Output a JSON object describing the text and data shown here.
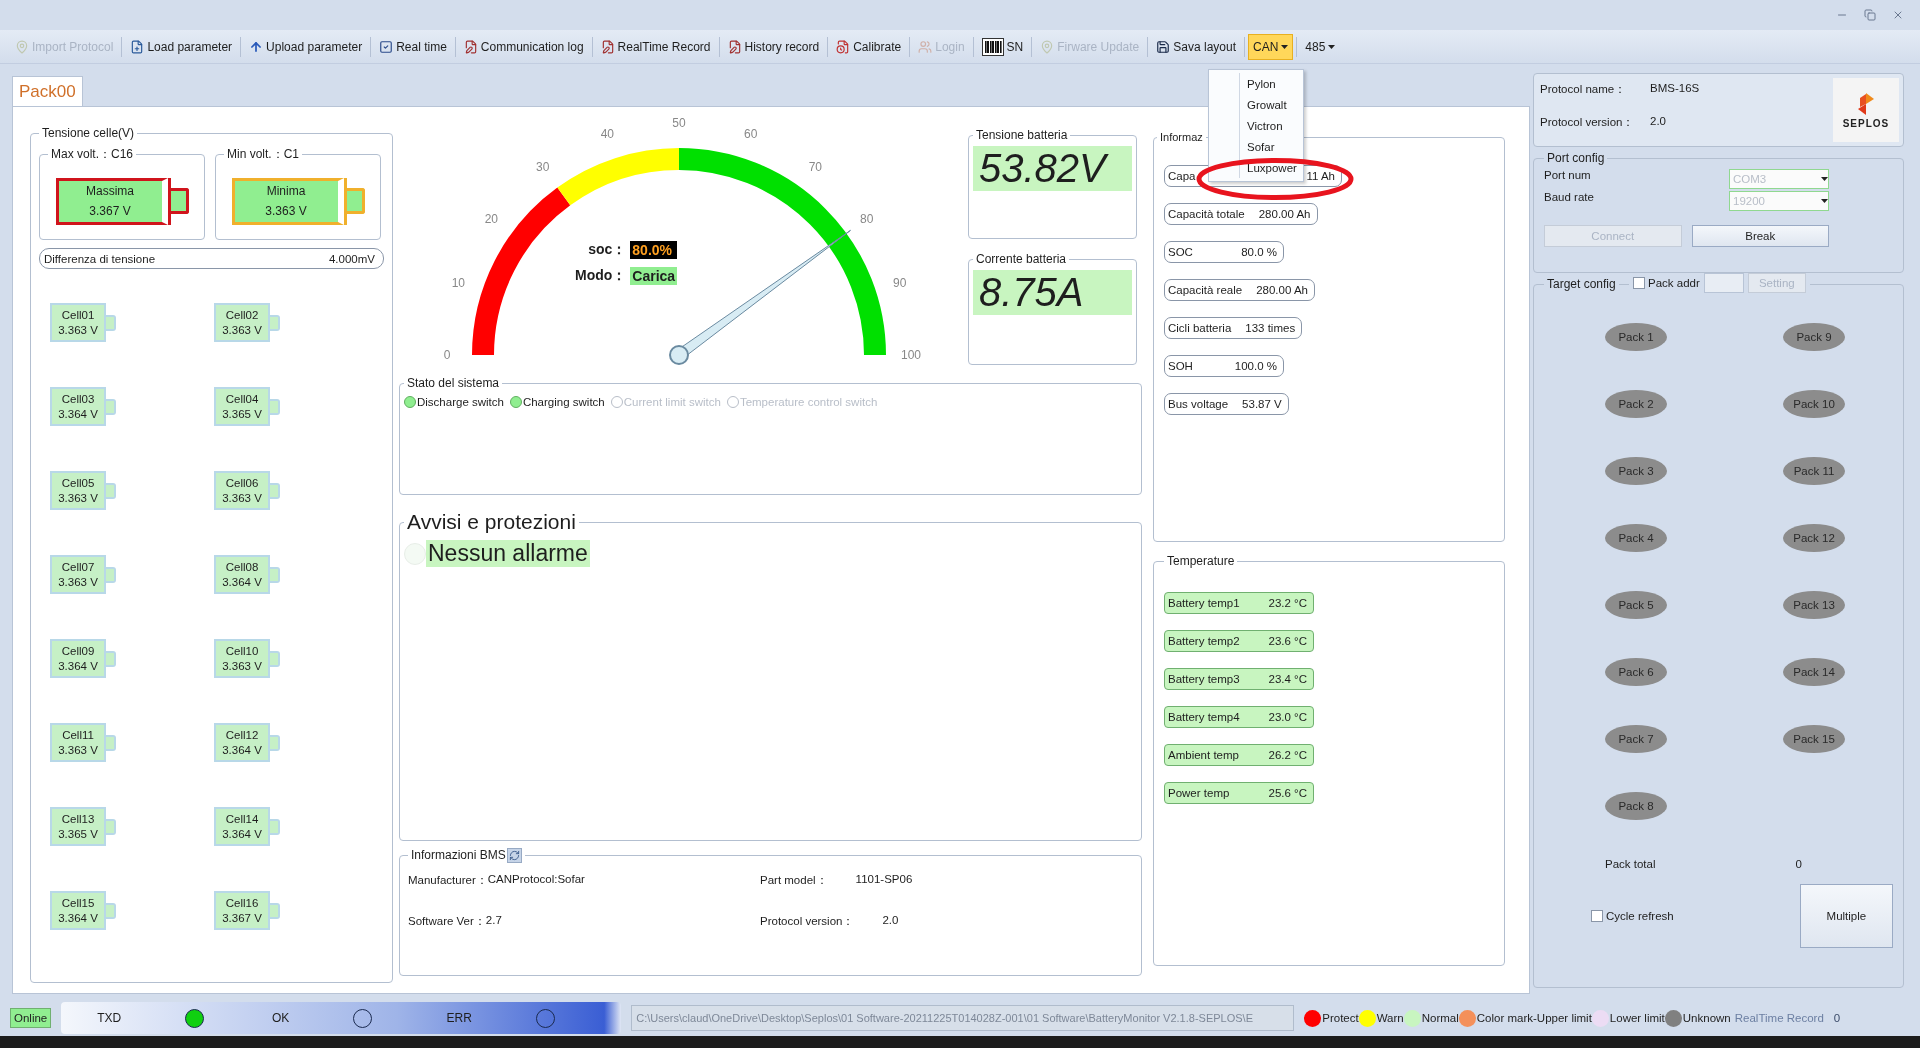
{
  "toolbar": [
    {
      "label": "Import Protocol",
      "kind": "button",
      "disabled": true
    },
    {
      "label": "Load parameter",
      "kind": "button",
      "disabled": false
    },
    {
      "label": "Upload parameter",
      "kind": "button",
      "disabled": false
    },
    {
      "label": "Real time",
      "kind": "button",
      "disabled": false
    },
    {
      "label": "Communication log",
      "kind": "button",
      "disabled": false
    },
    {
      "label": "RealTime Record",
      "kind": "button",
      "disabled": false
    },
    {
      "label": "History record",
      "kind": "button",
      "disabled": false
    },
    {
      "label": "Calibrate",
      "kind": "button",
      "disabled": false
    },
    {
      "label": "Login",
      "kind": "button",
      "disabled": true
    },
    {
      "label": "SN",
      "kind": "button",
      "disabled": false
    },
    {
      "label": "Firware Update",
      "kind": "button",
      "disabled": true
    },
    {
      "label": "Sava layout",
      "kind": "button",
      "disabled": false
    },
    {
      "label": "CAN",
      "kind": "dropdown",
      "open": true
    },
    {
      "label": "485",
      "kind": "dropdown",
      "open": false
    }
  ],
  "can_menu": [
    "Pylon",
    "Growalt",
    "Victron",
    "Sofar",
    "Luxpower"
  ],
  "annotations": [
    {
      "kind": "ellipse"
    }
  ],
  "tabs": [
    {
      "label": "Pack00",
      "selected": true
    }
  ],
  "cell_voltage": {
    "title": "Tensione celle(V)",
    "extremes": [
      {
        "title": "Max volt.：C16",
        "label": "Massima",
        "value": "3.367 V",
        "color": "#d0141c"
      },
      {
        "title": "Min volt.：C1",
        "label": "Minima",
        "value": "3.363 V",
        "color": "#f0b02c"
      }
    ],
    "difference": {
      "label": "Differenza di tensione",
      "value": "4.000mV"
    },
    "cells": [
      {
        "name": "Cell01",
        "value": "3.363 V"
      },
      {
        "name": "Cell02",
        "value": "3.363 V"
      },
      {
        "name": "Cell03",
        "value": "3.364 V"
      },
      {
        "name": "Cell04",
        "value": "3.365 V"
      },
      {
        "name": "Cell05",
        "value": "3.363 V"
      },
      {
        "name": "Cell06",
        "value": "3.363 V"
      },
      {
        "name": "Cell07",
        "value": "3.363 V"
      },
      {
        "name": "Cell08",
        "value": "3.364 V"
      },
      {
        "name": "Cell09",
        "value": "3.364 V"
      },
      {
        "name": "Cell10",
        "value": "3.363 V"
      },
      {
        "name": "Cell11",
        "value": "3.363 V"
      },
      {
        "name": "Cell12",
        "value": "3.364 V"
      },
      {
        "name": "Cell13",
        "value": "3.365 V"
      },
      {
        "name": "Cell14",
        "value": "3.364 V"
      },
      {
        "name": "Cell15",
        "value": "3.364 V"
      },
      {
        "name": "Cell16",
        "value": "3.367 V"
      }
    ]
  },
  "gauge": {
    "ticks": [
      "0",
      "10",
      "20",
      "30",
      "40",
      "50",
      "60",
      "70",
      "80",
      "90",
      "100"
    ],
    "level": 0.8,
    "soc_label": "soc：",
    "soc": "80.0%",
    "mode_label": "Modo：",
    "mode": "Carica"
  },
  "readouts": [
    {
      "title": "Tensione batteria",
      "value": "53.82V"
    },
    {
      "title": "Corrente batteria",
      "value": "8.75A"
    }
  ],
  "system_state": {
    "title": "Stato del sistema",
    "switches": [
      {
        "label": "Discharge switch",
        "on": true
      },
      {
        "label": "Charging switch",
        "on": true
      },
      {
        "label": "Current limit switch",
        "on": false
      },
      {
        "label": "Temperature control switch",
        "on": false
      }
    ]
  },
  "alarms": {
    "title": "Avvisi e protezioni",
    "items": [
      "Nessun allarme"
    ]
  },
  "bms_info": {
    "title": "Informazioni BMS",
    "fields": [
      {
        "label": "Manufacturer：",
        "value": "CANProtocol:Sofar"
      },
      {
        "label": "Part model：",
        "value": "1101-SP06"
      },
      {
        "label": "Software Ver：",
        "value": "2.7"
      },
      {
        "label": "Protocol version：",
        "value": "2.0"
      }
    ]
  },
  "info": {
    "title": "Informaz",
    "rows": [
      {
        "label": "Capa",
        "value": "11 Ah"
      },
      {
        "label": "Capacità totale",
        "value": "280.00 Ah"
      },
      {
        "label": "SOC",
        "value": "80.0 %"
      },
      {
        "label": "Capacità reale",
        "value": "280.00 Ah"
      },
      {
        "label": "Cicli batteria",
        "value": "133 times"
      },
      {
        "label": "SOH",
        "value": "100.0 %"
      },
      {
        "label": "Bus voltage",
        "value": "53.87 V"
      }
    ]
  },
  "temperature": {
    "title": "Temperature",
    "rows": [
      {
        "label": "Battery temp1",
        "value": "23.2 °C"
      },
      {
        "label": "Battery temp2",
        "value": "23.6 °C"
      },
      {
        "label": "Battery temp3",
        "value": "23.4 °C"
      },
      {
        "label": "Battery temp4",
        "value": "23.0 °C"
      },
      {
        "label": "Ambient temp",
        "value": "26.2 °C"
      },
      {
        "label": "Power temp",
        "value": "25.6 °C"
      }
    ]
  },
  "protocol": {
    "name_label": "Protocol name：",
    "name": "BMS-16S",
    "version_label": "Protocol version：",
    "version": "2.0",
    "logo": "SEPLOS"
  },
  "port_config": {
    "title": "Port config",
    "port_label": "Port num",
    "port": "COM3",
    "baud_label": "Baud rate",
    "baud": "19200",
    "buttons": [
      {
        "label": "Connect",
        "disabled": true
      },
      {
        "label": "Break",
        "disabled": false
      }
    ]
  },
  "target_config": {
    "title": "Target config",
    "pack_addr": {
      "label": "Pack addr",
      "checked": false
    },
    "setting": {
      "label": "Setting",
      "disabled": true
    },
    "packs": [
      "Pack 1",
      "Pack 2",
      "Pack 3",
      "Pack 4",
      "Pack 5",
      "Pack 6",
      "Pack 7",
      "Pack 8",
      "Pack 9",
      "Pack 10",
      "Pack 11",
      "Pack 12",
      "Pack 13",
      "Pack 14",
      "Pack 15"
    ],
    "total_label": "Pack total",
    "total": "0",
    "cycle_refresh": {
      "label": "Cycle refresh",
      "checked": false
    },
    "multiple": "Multiple"
  },
  "status_bar": {
    "online": "Online",
    "signals": [
      {
        "label": "TXD",
        "on": true
      },
      {
        "label": "OK",
        "on": false
      },
      {
        "label": "ERR",
        "on": false
      }
    ],
    "path": "C:\\Users\\claud\\OneDrive\\Desktop\\Seplos\\01 Software-20211225T014028Z-001\\01 Software\\BatteryMonitor V2.1.8-SEPLOS\\E",
    "legend": [
      {
        "label": "Protect",
        "color": "#ff0000"
      },
      {
        "label": "Warn",
        "color": "#ffff00"
      },
      {
        "label": "Normal",
        "color": "#c8f5c0"
      },
      {
        "label": "Color mark-Upper limit",
        "color": "#f4905a"
      },
      {
        "label": "Lower limit",
        "color": "#ecdcf4"
      },
      {
        "label": "Unknown",
        "color": "#808080"
      }
    ],
    "record_label": "RealTime Record",
    "record_count": "0"
  }
}
